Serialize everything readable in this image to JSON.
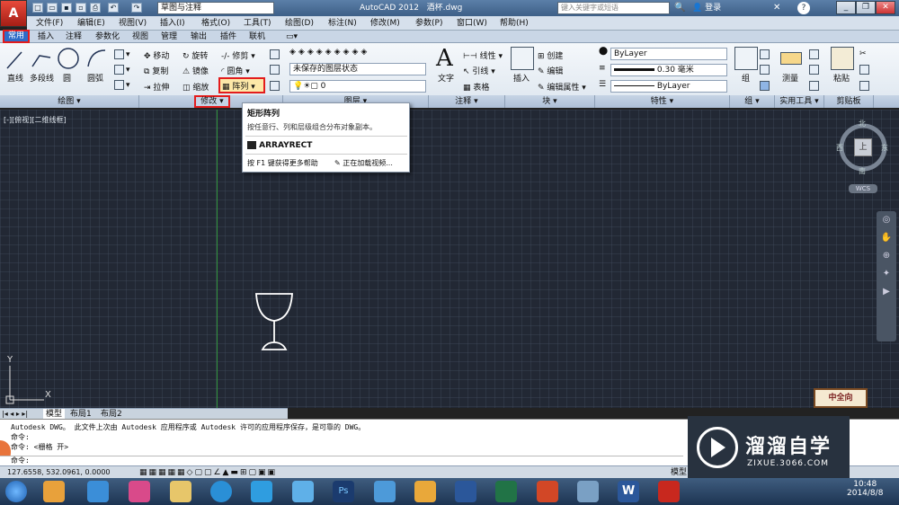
{
  "titlebar": {
    "workspace": "草图与注释",
    "app_title": "AutoCAD 2012",
    "file": "酒杯.dwg",
    "search_placeholder": "键入关键字或短语",
    "login": "登录"
  },
  "menu": [
    "文件(F)",
    "编辑(E)",
    "视图(V)",
    "插入(I)",
    "格式(O)",
    "工具(T)",
    "绘图(D)",
    "标注(N)",
    "修改(M)",
    "参数(P)",
    "窗口(W)",
    "帮助(H)"
  ],
  "tabs": [
    "常用",
    "插入",
    "注释",
    "参数化",
    "视图",
    "管理",
    "输出",
    "插件",
    "联机"
  ],
  "draw": {
    "line": "直线",
    "polyline": "多段线",
    "circle": "圆",
    "arc": "圆弧",
    "panel": "绘图"
  },
  "modify": {
    "move": "移动",
    "rotate": "旋转",
    "trim": "修剪",
    "copy": "复制",
    "mirror": "镜像",
    "fillet": "圆角",
    "stretch": "拉伸",
    "scale": "缩放",
    "array": "阵列",
    "panel": "修改"
  },
  "layers": {
    "state": "未保存的图层状态",
    "layer": "0",
    "panel": "图层"
  },
  "annotation": {
    "text": "文字",
    "linear": "线性",
    "leader": "引线",
    "table": "表格",
    "panel": "注释"
  },
  "block": {
    "insert": "插入",
    "create": "创建",
    "edit": "编辑",
    "attr": "编辑属性",
    "panel": "块"
  },
  "properties": {
    "color": "ByLayer",
    "lineweight": "0.30 毫米",
    "linetype": "ByLayer",
    "panel": "特性"
  },
  "groups": {
    "group": "组",
    "panel": "组"
  },
  "utilities": {
    "measure": "测量",
    "panel": "实用工具"
  },
  "clipboard": {
    "paste": "粘贴",
    "panel": "剪贴板"
  },
  "viewport": {
    "label": "[-][俯视][二维线框]",
    "compass_n": "北",
    "compass_s": "南",
    "compass_w": "西",
    "compass_e": "东",
    "compass_top": "上",
    "wcs": "WCS"
  },
  "tooltip": {
    "title": "矩形阵列",
    "desc": "按任意行、列和层级组合分布对象副本。",
    "command": "ARRAYRECT",
    "help": "按 F1 键获得更多帮助",
    "video": "正在加载视频..."
  },
  "ucs": {
    "y": "Y",
    "x": "X"
  },
  "layout_tabs": [
    "模型",
    "布局1",
    "布局2"
  ],
  "command_lines": [
    "Autodesk DWG。  此文件上次由 Autodesk 应用程序或 Autodesk 许可的应用程序保存，是可靠的 DWG。",
    "命令:",
    "命令:  <栅格 开>",
    "命令:"
  ],
  "status": {
    "coords": "127.6558, 532.0961, 0.0000",
    "model": "模型"
  },
  "watermark": {
    "title": "溜溜自学",
    "url": "ZIXUE.3066.COM",
    "badge": "中全向"
  },
  "clock": {
    "time": "10:48",
    "date": "2014/8/8"
  }
}
